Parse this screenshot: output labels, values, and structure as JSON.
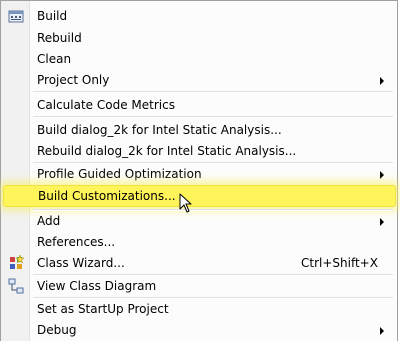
{
  "menu": {
    "items": [
      {
        "label": "Build",
        "icon": "build-icon"
      },
      {
        "label": "Rebuild"
      },
      {
        "label": "Clean"
      },
      {
        "label": "Project Only",
        "submenu": true
      },
      {
        "label": "Calculate Code Metrics"
      },
      {
        "label": "Build dialog_2k for Intel Static Analysis..."
      },
      {
        "label": "Rebuild dialog_2k for Intel Static Analysis..."
      },
      {
        "label": "Profile Guided Optimization",
        "submenu": true
      },
      {
        "label": "Build Customizations...",
        "highlighted": true
      },
      {
        "label": "Add",
        "submenu": true
      },
      {
        "label": "References..."
      },
      {
        "label": "Class Wizard...",
        "shortcut": "Ctrl+Shift+X",
        "icon": "class-wizard-icon"
      },
      {
        "label": "View Class Diagram",
        "icon": "class-diagram-icon"
      },
      {
        "label": "Set as StartUp Project"
      },
      {
        "label": "Debug",
        "submenu": true
      }
    ]
  },
  "colors": {
    "highlight": "#fff45a",
    "gutter": "#f1f1f1",
    "separator": "#e0e0e0"
  }
}
